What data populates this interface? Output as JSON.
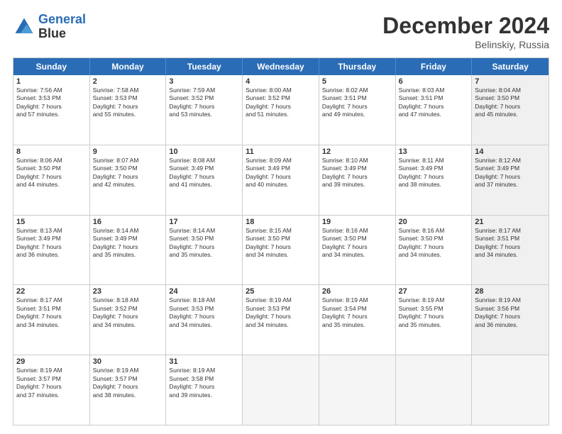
{
  "header": {
    "logo": {
      "line1": "General",
      "line2": "Blue"
    },
    "title": "December 2024",
    "subtitle": "Belinskiy, Russia"
  },
  "days_of_week": [
    "Sunday",
    "Monday",
    "Tuesday",
    "Wednesday",
    "Thursday",
    "Friday",
    "Saturday"
  ],
  "weeks": [
    [
      {
        "day": "1",
        "text": "Sunrise: 7:56 AM\nSunset: 3:53 PM\nDaylight: 7 hours\nand 57 minutes.",
        "shaded": false
      },
      {
        "day": "2",
        "text": "Sunrise: 7:58 AM\nSunset: 3:53 PM\nDaylight: 7 hours\nand 55 minutes.",
        "shaded": false
      },
      {
        "day": "3",
        "text": "Sunrise: 7:59 AM\nSunset: 3:52 PM\nDaylight: 7 hours\nand 53 minutes.",
        "shaded": false
      },
      {
        "day": "4",
        "text": "Sunrise: 8:00 AM\nSunset: 3:52 PM\nDaylight: 7 hours\nand 51 minutes.",
        "shaded": false
      },
      {
        "day": "5",
        "text": "Sunrise: 8:02 AM\nSunset: 3:51 PM\nDaylight: 7 hours\nand 49 minutes.",
        "shaded": false
      },
      {
        "day": "6",
        "text": "Sunrise: 8:03 AM\nSunset: 3:51 PM\nDaylight: 7 hours\nand 47 minutes.",
        "shaded": false
      },
      {
        "day": "7",
        "text": "Sunrise: 8:04 AM\nSunset: 3:50 PM\nDaylight: 7 hours\nand 45 minutes.",
        "shaded": true
      }
    ],
    [
      {
        "day": "8",
        "text": "Sunrise: 8:06 AM\nSunset: 3:50 PM\nDaylight: 7 hours\nand 44 minutes.",
        "shaded": false
      },
      {
        "day": "9",
        "text": "Sunrise: 8:07 AM\nSunset: 3:50 PM\nDaylight: 7 hours\nand 42 minutes.",
        "shaded": false
      },
      {
        "day": "10",
        "text": "Sunrise: 8:08 AM\nSunset: 3:49 PM\nDaylight: 7 hours\nand 41 minutes.",
        "shaded": false
      },
      {
        "day": "11",
        "text": "Sunrise: 8:09 AM\nSunset: 3:49 PM\nDaylight: 7 hours\nand 40 minutes.",
        "shaded": false
      },
      {
        "day": "12",
        "text": "Sunrise: 8:10 AM\nSunset: 3:49 PM\nDaylight: 7 hours\nand 39 minutes.",
        "shaded": false
      },
      {
        "day": "13",
        "text": "Sunrise: 8:11 AM\nSunset: 3:49 PM\nDaylight: 7 hours\nand 38 minutes.",
        "shaded": false
      },
      {
        "day": "14",
        "text": "Sunrise: 8:12 AM\nSunset: 3:49 PM\nDaylight: 7 hours\nand 37 minutes.",
        "shaded": true
      }
    ],
    [
      {
        "day": "15",
        "text": "Sunrise: 8:13 AM\nSunset: 3:49 PM\nDaylight: 7 hours\nand 36 minutes.",
        "shaded": false
      },
      {
        "day": "16",
        "text": "Sunrise: 8:14 AM\nSunset: 3:49 PM\nDaylight: 7 hours\nand 35 minutes.",
        "shaded": false
      },
      {
        "day": "17",
        "text": "Sunrise: 8:14 AM\nSunset: 3:50 PM\nDaylight: 7 hours\nand 35 minutes.",
        "shaded": false
      },
      {
        "day": "18",
        "text": "Sunrise: 8:15 AM\nSunset: 3:50 PM\nDaylight: 7 hours\nand 34 minutes.",
        "shaded": false
      },
      {
        "day": "19",
        "text": "Sunrise: 8:16 AM\nSunset: 3:50 PM\nDaylight: 7 hours\nand 34 minutes.",
        "shaded": false
      },
      {
        "day": "20",
        "text": "Sunrise: 8:16 AM\nSunset: 3:50 PM\nDaylight: 7 hours\nand 34 minutes.",
        "shaded": false
      },
      {
        "day": "21",
        "text": "Sunrise: 8:17 AM\nSunset: 3:51 PM\nDaylight: 7 hours\nand 34 minutes.",
        "shaded": true
      }
    ],
    [
      {
        "day": "22",
        "text": "Sunrise: 8:17 AM\nSunset: 3:51 PM\nDaylight: 7 hours\nand 34 minutes.",
        "shaded": false
      },
      {
        "day": "23",
        "text": "Sunrise: 8:18 AM\nSunset: 3:52 PM\nDaylight: 7 hours\nand 34 minutes.",
        "shaded": false
      },
      {
        "day": "24",
        "text": "Sunrise: 8:18 AM\nSunset: 3:53 PM\nDaylight: 7 hours\nand 34 minutes.",
        "shaded": false
      },
      {
        "day": "25",
        "text": "Sunrise: 8:19 AM\nSunset: 3:53 PM\nDaylight: 7 hours\nand 34 minutes.",
        "shaded": false
      },
      {
        "day": "26",
        "text": "Sunrise: 8:19 AM\nSunset: 3:54 PM\nDaylight: 7 hours\nand 35 minutes.",
        "shaded": false
      },
      {
        "day": "27",
        "text": "Sunrise: 8:19 AM\nSunset: 3:55 PM\nDaylight: 7 hours\nand 35 minutes.",
        "shaded": false
      },
      {
        "day": "28",
        "text": "Sunrise: 8:19 AM\nSunset: 3:56 PM\nDaylight: 7 hours\nand 36 minutes.",
        "shaded": true
      }
    ],
    [
      {
        "day": "29",
        "text": "Sunrise: 8:19 AM\nSunset: 3:57 PM\nDaylight: 7 hours\nand 37 minutes.",
        "shaded": false
      },
      {
        "day": "30",
        "text": "Sunrise: 8:19 AM\nSunset: 3:57 PM\nDaylight: 7 hours\nand 38 minutes.",
        "shaded": false
      },
      {
        "day": "31",
        "text": "Sunrise: 8:19 AM\nSunset: 3:58 PM\nDaylight: 7 hours\nand 39 minutes.",
        "shaded": false
      },
      {
        "day": "",
        "text": "",
        "shaded": true,
        "empty": true
      },
      {
        "day": "",
        "text": "",
        "shaded": true,
        "empty": true
      },
      {
        "day": "",
        "text": "",
        "shaded": true,
        "empty": true
      },
      {
        "day": "",
        "text": "",
        "shaded": true,
        "empty": true
      }
    ]
  ]
}
